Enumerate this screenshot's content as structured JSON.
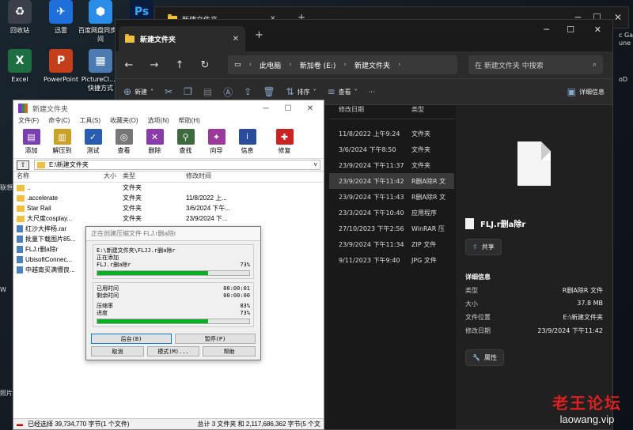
{
  "desktop": {
    "icons": [
      {
        "label": "回收站",
        "glyph": "♻",
        "color": "#3a3f4a"
      },
      {
        "label": "迅雷",
        "glyph": "✈",
        "color": "#1e6fd9"
      },
      {
        "label": "百度网盘同步空间",
        "glyph": "⬢",
        "color": "#2a8ee8"
      },
      {
        "label": "",
        "glyph": "Ps",
        "color": "#0a1c3e"
      },
      {
        "label": "Excel",
        "glyph": "X",
        "color": "#1d6f42"
      },
      {
        "label": "PowerPoint",
        "glyph": "P",
        "color": "#c43e1c"
      },
      {
        "label": "PictureCl... - 快捷方式",
        "glyph": "▦",
        "color": "#4c7bb3"
      }
    ],
    "edge_fragments": [
      "EP",
      "c Ga",
      "une",
      "oD",
      "联想",
      "W",
      "照片"
    ]
  },
  "explorer": {
    "ghost_tab_title": "新建文件夹",
    "tab_title": "新建文件夹",
    "breadcrumb": [
      "此电脑",
      "新加卷 (E:)",
      "新建文件夹"
    ],
    "search_placeholder": "在 新建文件夹 中搜索",
    "commands": {
      "new": "新建",
      "sort": "排序",
      "view": "查看",
      "more": "···",
      "details": "详细信息"
    },
    "columns": {
      "date": "修改日期",
      "type": "类型"
    },
    "rows": [
      {
        "date": "11/8/2022 上午9:24",
        "type": "文件夹"
      },
      {
        "date": "3/6/2024 下午8:50",
        "type": "文件夹"
      },
      {
        "date": "23/9/2024 下午11:37",
        "type": "文件夹"
      },
      {
        "date": "23/9/2024 下午11:42",
        "type": "R删A除R 文"
      },
      {
        "date": "23/9/2024 下午11:43",
        "type": "R删A除R 文"
      },
      {
        "date": "23/3/2024 下午10:40",
        "type": "应用程序"
      },
      {
        "date": "27/10/2023 下午2:56",
        "type": "WinRAR 压"
      },
      {
        "date": "23/9/2024 下午11:34",
        "type": "ZIP 文件"
      },
      {
        "date": "9/11/2023 下午9:40",
        "type": "JPG 文件"
      }
    ],
    "details": {
      "filename": "FLJ.r删a除r",
      "share": "共享",
      "heading": "详细信息",
      "fields": [
        {
          "k": "类型",
          "v": "R删A除R 文件"
        },
        {
          "k": "大小",
          "v": "37.8 MB"
        },
        {
          "k": "文件位置",
          "v": "E:\\新建文件夹"
        },
        {
          "k": "修改日期",
          "v": "23/9/2024 下午11:42"
        }
      ],
      "properties": "属性"
    }
  },
  "winrar": {
    "title": "新建文件夹",
    "menu": [
      "文件(F)",
      "命令(C)",
      "工具(S)",
      "收藏夹(O)",
      "选项(N)",
      "帮助(H)"
    ],
    "tools": [
      {
        "label": "添加",
        "color": "#7a3fb0"
      },
      {
        "label": "解压到",
        "color": "#c9a227"
      },
      {
        "label": "测试",
        "color": "#2a5db0"
      },
      {
        "label": "查看",
        "color": "#777777"
      },
      {
        "label": "删除",
        "color": "#8a3da8"
      },
      {
        "label": "查找",
        "color": "#3d6b3d"
      },
      {
        "label": "向导",
        "color": "#9b3a9b"
      },
      {
        "label": "信息",
        "color": "#2a4d9b"
      },
      {
        "label": "修复",
        "color": "#cc2222"
      }
    ],
    "path": "E:\\新建文件夹",
    "columns": {
      "name": "名称",
      "size": "大小",
      "type": "类型",
      "date": "修改时间"
    },
    "rows": [
      {
        "name": "..",
        "size": "",
        "type": "文件夹",
        "date": "",
        "icon": "folder"
      },
      {
        "name": ".accelerate",
        "size": "",
        "type": "文件夹",
        "date": "11/8/2022 上...",
        "icon": "folder"
      },
      {
        "name": "Star Rail",
        "size": "",
        "type": "文件夹",
        "date": "3/6/2024 下午...",
        "icon": "folder"
      },
      {
        "name": "大尺度cosplay...",
        "size": "",
        "type": "文件夹",
        "date": "23/9/2024 下...",
        "icon": "folder"
      },
      {
        "name": "红沙大摔杨.rar",
        "size": "10",
        "type": "",
        "date": "",
        "icon": "file"
      },
      {
        "name": "批量下载图片85...",
        "size": "",
        "type": "",
        "date": "",
        "icon": "file"
      },
      {
        "name": "FLJ.r删a除r",
        "size": "",
        "type": "",
        "date": "",
        "icon": "file"
      },
      {
        "name": "UbisoftConnec...",
        "size": "",
        "type": "",
        "date": "",
        "icon": "file"
      },
      {
        "name": "中越南买满懵良...",
        "size": "",
        "type": "",
        "date": "",
        "icon": "file"
      }
    ],
    "status_left": "已经选择 39,734,770 字节(1 个文件)",
    "status_right": "总计 3 文件夹 和 2,117,686,362 字节(5 个文"
  },
  "progress": {
    "title": "正在创建压缩文件 FLJ.r删a除r",
    "path": "E:\\新建文件夹\\FLJJ.r删a除r",
    "action": "正在添加",
    "file": "FLJ.r删a除r",
    "file_pct_label": "73%",
    "file_progress": 0.73,
    "elapsed_label": "已用时间",
    "elapsed": "00:00:01",
    "remaining_label": "剩余时间",
    "remaining": "00:00:00",
    "ratio_label": "压缩率",
    "ratio": "83%",
    "total_label": "进度",
    "total_pct_label": "73%",
    "total_progress": 0.73,
    "buttons": {
      "background": "后台(B)",
      "pause": "暂停(P)",
      "cancel": "取消",
      "mode": "模式(M)...",
      "help": "帮助"
    }
  },
  "watermark": {
    "line1": "老王论坛",
    "line2": "laowang.vip"
  }
}
